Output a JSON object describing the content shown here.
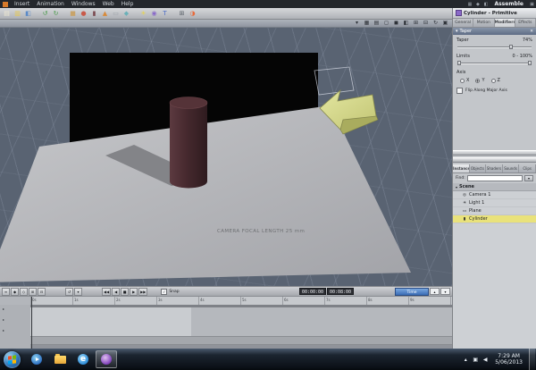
{
  "window": {
    "room_label": "Assemble"
  },
  "menubar": {
    "menus": [
      "Insert",
      "Animation",
      "Windows",
      "Web",
      "Help"
    ]
  },
  "toolbar": {
    "icons": [
      {
        "name": "new-scene",
        "glyph": "▤",
        "color": "#f0ead2"
      },
      {
        "name": "open-file",
        "glyph": "▥",
        "color": "#e8c84a"
      },
      {
        "name": "save",
        "glyph": "◧",
        "color": "#5a8ac8"
      },
      {
        "name": "undo",
        "glyph": "↺",
        "color": "#4a9a4a"
      },
      {
        "name": "redo",
        "glyph": "↻",
        "color": "#4a9a4a"
      },
      {
        "name": "insert-cube",
        "glyph": "■",
        "color": "#c8a46a"
      },
      {
        "name": "insert-sphere",
        "glyph": "●",
        "color": "#c85a4a"
      },
      {
        "name": "insert-cylinder",
        "glyph": "▮",
        "color": "#7a4a50"
      },
      {
        "name": "insert-cone",
        "glyph": "▲",
        "color": "#d88a3a"
      },
      {
        "name": "insert-plane",
        "glyph": "▭",
        "color": "#9aa0a8"
      },
      {
        "name": "insert-vertex-object",
        "glyph": "◆",
        "color": "#6ab0b8"
      },
      {
        "name": "insert-light",
        "glyph": "☀",
        "color": "#e8d44a"
      },
      {
        "name": "insert-camera",
        "glyph": "◉",
        "color": "#8a6ac8"
      },
      {
        "name": "insert-text",
        "glyph": "T",
        "color": "#4a6ac8"
      },
      {
        "name": "group-objects",
        "glyph": "⊞",
        "color": "#5a6068"
      },
      {
        "name": "render",
        "glyph": "◑",
        "color": "#e86a3a"
      }
    ]
  },
  "viewport": {
    "camera_text": "CAMERA FOCAL LENGTH 25 mm",
    "toolbar_icons": [
      {
        "name": "camera-menu",
        "glyph": "▾"
      },
      {
        "name": "wireframe-mode",
        "glyph": "▦"
      },
      {
        "name": "flat-shade-mode",
        "glyph": "▤"
      },
      {
        "name": "smooth-shade-mode",
        "glyph": "◻"
      },
      {
        "name": "textured-mode",
        "glyph": "◼"
      },
      {
        "name": "lighting-toggle",
        "glyph": "◧"
      },
      {
        "name": "grid-toggle",
        "glyph": "⊞"
      },
      {
        "name": "zoom-tool",
        "glyph": "⊟"
      },
      {
        "name": "rotate-view-tool",
        "glyph": "↻"
      },
      {
        "name": "maximize-view",
        "glyph": "▣"
      }
    ]
  },
  "right_panel": {
    "title": "Cylinder - Primitive",
    "tabs": [
      "General",
      "Motion",
      "Modifiers",
      "Effects"
    ],
    "active_tab": "Modifiers",
    "taper": {
      "section_title": "Taper",
      "collapse_glyph": "▾",
      "remove_glyph": "✕",
      "taper_label": "Taper",
      "taper_value": "74%",
      "limits_label": "Limits",
      "limits_value": "0 - 100%",
      "axis_label": "Axis",
      "axis_options": [
        "X",
        "Y",
        "Z"
      ],
      "flip_label": "Flip Along Major Axis"
    },
    "browser_tabs": [
      "Instances",
      "Objects",
      "Shaders",
      "Sounds",
      "Clips"
    ],
    "find_label": "Find:",
    "find_dd_glyph": "▾",
    "scene": {
      "title": "Scene",
      "twist_glyph": "▾",
      "items": [
        {
          "icon": "◎",
          "name": "camera-1",
          "label": "Camera 1"
        },
        {
          "icon": "☀",
          "name": "light-1",
          "label": "Light 1"
        },
        {
          "icon": "▭",
          "name": "plane",
          "label": "Plane"
        },
        {
          "icon": "▮",
          "name": "cylinder",
          "label": "Cylinder"
        }
      ]
    }
  },
  "timeline": {
    "left_buttons": [
      {
        "name": "track-menu",
        "glyph": "≡"
      },
      {
        "name": "add-keyframe",
        "glyph": "◆"
      },
      {
        "name": "delete-keyframe",
        "glyph": "◇"
      },
      {
        "name": "expand-tracks",
        "glyph": "⊞"
      },
      {
        "name": "collapse-tracks",
        "glyph": "⊟"
      }
    ],
    "option_buttons": [
      {
        "name": "loop-toggle",
        "glyph": "↺"
      },
      {
        "name": "timeline-options",
        "glyph": "▾"
      }
    ],
    "transport": [
      {
        "name": "go-to-start",
        "glyph": "◀◀"
      },
      {
        "name": "step-back",
        "glyph": "◀"
      },
      {
        "name": "stop",
        "glyph": "■"
      },
      {
        "name": "play",
        "glyph": "▶"
      },
      {
        "name": "go-to-end",
        "glyph": "▶▶"
      }
    ],
    "snap_label": "Snap",
    "snap_checked": "✓",
    "current_time": "00:00:00",
    "end_time": "00:08:00",
    "display_mode": "Time",
    "spin_up": "▴",
    "spin_down": "▾",
    "expander_glyph": "▸",
    "ruler_ticks": [
      "0s",
      "1s",
      "2s",
      "3s",
      "4s",
      "5s",
      "6s",
      "7s",
      "8s",
      "9s"
    ]
  },
  "taskbar": {
    "flag_colors": [
      "#f25022",
      "#7fba00",
      "#00a4ef",
      "#ffb900"
    ],
    "apps": [
      {
        "name": "media-player"
      },
      {
        "name": "explorer"
      },
      {
        "name": "internet-explorer",
        "glyph": "e"
      },
      {
        "name": "carrara",
        "active": true
      }
    ],
    "tray_icons": [
      {
        "name": "hidden-icons-chevron",
        "glyph": "▴"
      },
      {
        "name": "network-icon",
        "glyph": "▣"
      },
      {
        "name": "volume-icon",
        "glyph": "◀"
      }
    ],
    "time": "7:29 AM",
    "date": "5/06/2013"
  },
  "colors": {
    "selection_yellow": "#e9e27b",
    "viewport_background": "#596372",
    "ground_plane_gray": "#b4b5b9",
    "cylinder_maroon": "#46292e",
    "arrow_yellow": "#d9dc8f",
    "dropdown_blue": "#3a6cb4"
  }
}
